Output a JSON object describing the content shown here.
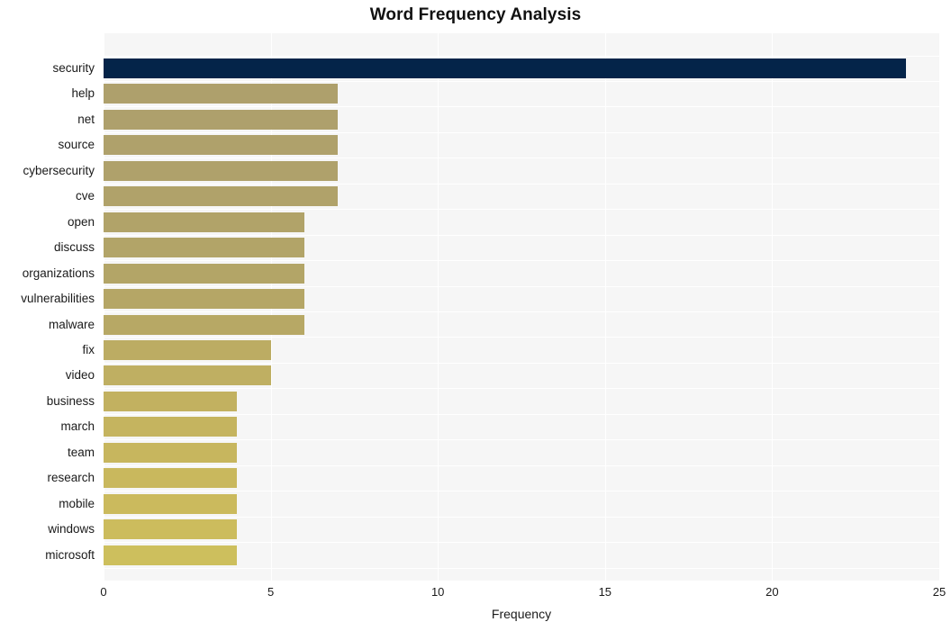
{
  "chart_data": {
    "type": "bar",
    "orientation": "horizontal",
    "title": "Word Frequency Analysis",
    "xlabel": "Frequency",
    "ylabel": "",
    "xlim": [
      0,
      25
    ],
    "ylim": null,
    "xticks": [
      0,
      5,
      10,
      15,
      20,
      25
    ],
    "xtick_labels": [
      "0",
      "5",
      "10",
      "15",
      "20",
      "25"
    ],
    "grid": true,
    "legend": null,
    "categories": [
      "security",
      "help",
      "net",
      "source",
      "cybersecurity",
      "cve",
      "open",
      "discuss",
      "organizations",
      "vulnerabilities",
      "malware",
      "fix",
      "video",
      "business",
      "march",
      "team",
      "research",
      "mobile",
      "windows",
      "microsoft"
    ],
    "values": [
      24,
      7,
      7,
      7,
      7,
      7,
      6,
      6,
      6,
      6,
      6,
      5,
      5,
      4,
      4,
      4,
      4,
      4,
      4,
      4
    ],
    "bar_colors": [
      "#042449",
      "#aea06c",
      "#aea06c",
      "#afa16b",
      "#afa16b",
      "#b0a26a",
      "#b1a369",
      "#b2a468",
      "#b3a567",
      "#b5a666",
      "#b7a865",
      "#bcac63",
      "#bfaf62",
      "#c2b160",
      "#c5b45f",
      "#c7b65e",
      "#c9b85d",
      "#cbba5d",
      "#ccbc5d",
      "#cdbf5d"
    ],
    "plot_background": "#f6f6f6",
    "grid_color": "#ffffff",
    "figure_background": "#ffffff",
    "title_color": "#111111"
  }
}
